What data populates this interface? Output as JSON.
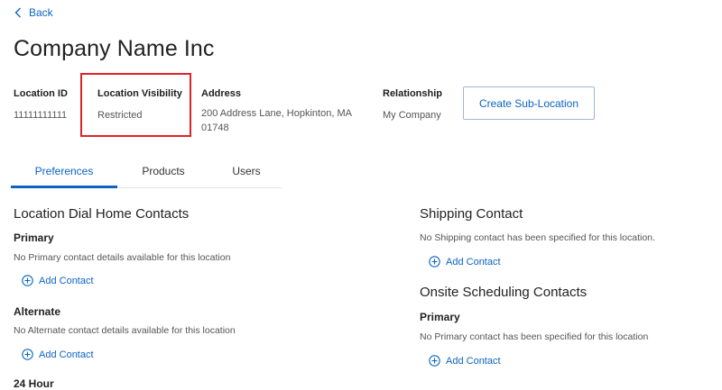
{
  "nav": {
    "back_label": "Back"
  },
  "company": {
    "name": "Company Name Inc"
  },
  "fields": {
    "location_id": {
      "label": "Location ID",
      "value": "11111111111"
    },
    "location_visibility": {
      "label": "Location Visibility",
      "value": "Restricted"
    },
    "address": {
      "label": "Address",
      "line1": "200 Address Lane, Hopkinton, MA",
      "line2": "01748"
    },
    "relationship": {
      "label": "Relationship",
      "value": "My Company"
    }
  },
  "actions": {
    "create_sub_location": "Create Sub-Location"
  },
  "tabs": [
    {
      "label": "Preferences",
      "active": true
    },
    {
      "label": "Products",
      "active": false
    },
    {
      "label": "Users",
      "active": false
    }
  ],
  "dial_home": {
    "title": "Location Dial Home Contacts",
    "primary": {
      "title": "Primary",
      "message": "No Primary contact details available for this location",
      "add_label": "Add Contact"
    },
    "alternate": {
      "title": "Alternate",
      "message": "No Alternate contact details available for this location",
      "add_label": "Add Contact"
    },
    "next_title_partial": "24 Hour"
  },
  "shipping": {
    "title": "Shipping Contact",
    "message": "No Shipping contact has been specified for this location.",
    "add_label": "Add Contact"
  },
  "onsite": {
    "title": "Onsite Scheduling Contacts",
    "primary": {
      "title": "Primary",
      "message": "No Primary contact has been specified for this location",
      "add_label": "Add Contact"
    }
  },
  "colors": {
    "accent": "#0c64c0",
    "highlight": "#e0222a"
  }
}
